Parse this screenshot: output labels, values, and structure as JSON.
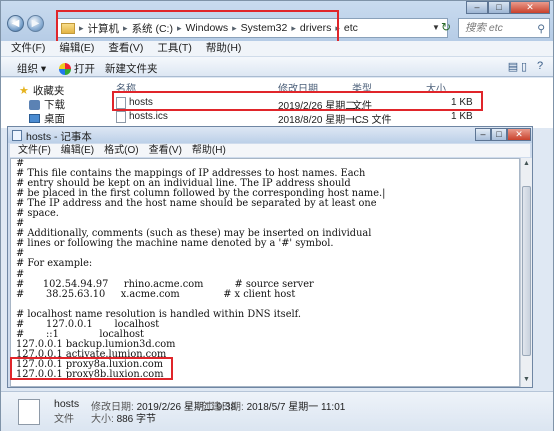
{
  "explorer": {
    "breadcrumbs": [
      "计算机",
      "系统 (C:)",
      "Windows",
      "System32",
      "drivers",
      "etc"
    ],
    "search_placeholder": "搜索 etc",
    "menu": [
      "文件(F)",
      "编辑(E)",
      "查看(V)",
      "工具(T)",
      "帮助(H)"
    ],
    "toolbar": {
      "organize": "组织 ▾",
      "open": "打开",
      "new_folder": "新建文件夹"
    },
    "nav": {
      "favorites": "收藏夹",
      "downloads": "下载",
      "desktop": "桌面"
    },
    "columns": {
      "name": "名称",
      "date": "修改日期",
      "type": "类型",
      "size": "大小"
    },
    "files": [
      {
        "name": "hosts",
        "date": "2019/2/26 星期二...",
        "type": "文件",
        "size": "1 KB"
      },
      {
        "name": "hosts.ics",
        "date": "2018/8/20 星期一...",
        "type": "ICS 文件",
        "size": "1 KB"
      }
    ]
  },
  "notepad": {
    "title": "hosts - 记事本",
    "menu": [
      "文件(F)",
      "编辑(E)",
      "格式(O)",
      "查看(V)",
      "帮助(H)"
    ],
    "content": "#\n# This file contains the mappings of IP addresses to host names. Each\n# entry should be kept on an individual line. The IP address should\n# be placed in the first column followed by the corresponding host name.|\n# The IP address and the host name should be separated by at least one\n# space.\n#\n# Additionally, comments (such as these) may be inserted on individual\n# lines or following the machine name denoted by a '#' symbol.\n#\n# For example:\n#\n#      102.54.94.97     rhino.acme.com          # source server\n#       38.25.63.10     x.acme.com              # x client host\n\n# localhost name resolution is handled within DNS itself.\n#       127.0.0.1       localhost\n#       ::1             localhost\n127.0.0.1 backup.lumion3d.com\n127.0.0.1 activate.lumion.com\n127.0.0.1 proxy8a.luxion.com\n127.0.0.1 proxy8b.luxion.com"
  },
  "details": {
    "name": "hosts",
    "modified_label": "修改日期:",
    "modified": "2019/2/26 星期二 9:38",
    "created_label": "创建日期:",
    "created": "2018/5/7 星期一 11:01",
    "type": "文件",
    "size_label": "大小:",
    "size": "886 字节"
  },
  "colors": {
    "highlight": "#e0252a",
    "chrome": "#dfe8f3"
  }
}
